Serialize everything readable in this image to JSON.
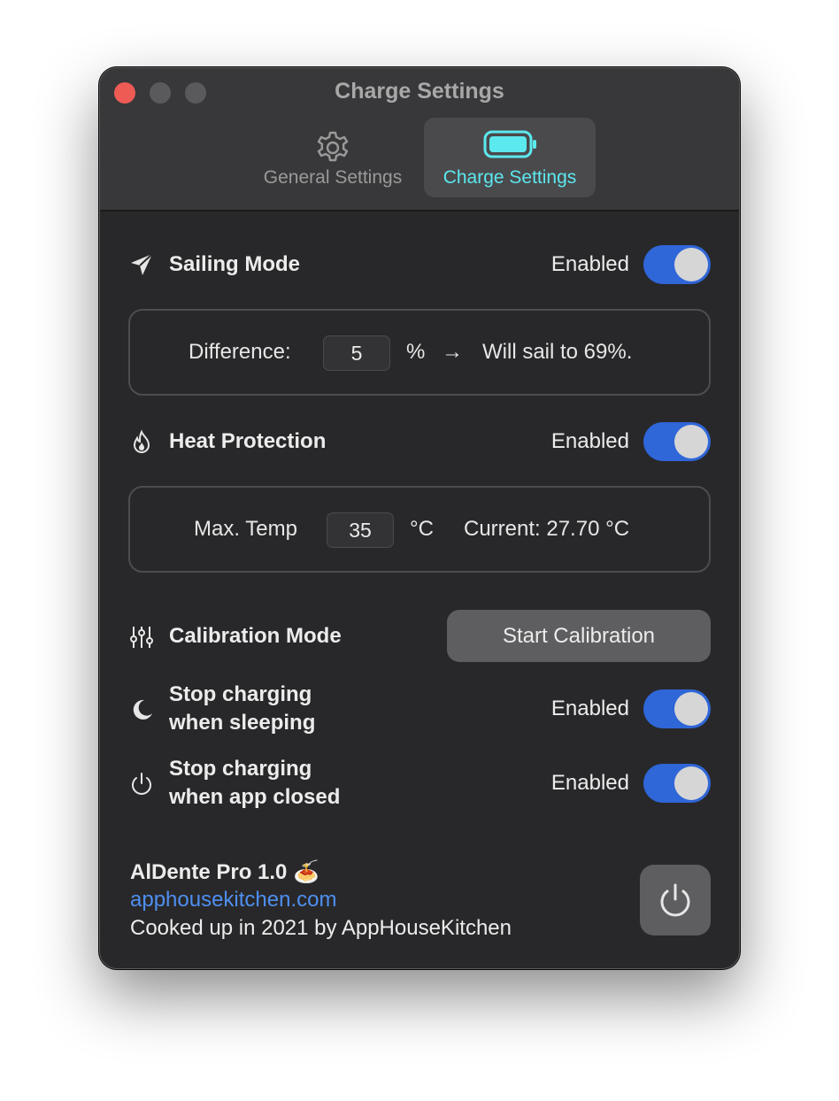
{
  "window": {
    "title": "Charge Settings"
  },
  "tabs": [
    {
      "label": "General Settings",
      "icon": "gear-icon",
      "selected": false
    },
    {
      "label": "Charge Settings",
      "icon": "battery-icon",
      "selected": true
    }
  ],
  "sailing": {
    "title": "Sailing Mode",
    "status": "Enabled",
    "enabled": true,
    "difference_label": "Difference:",
    "difference_value": "5",
    "unit": "%",
    "arrow": "→",
    "result": "Will sail to 69%."
  },
  "heat": {
    "title": "Heat Protection",
    "status": "Enabled",
    "enabled": true,
    "max_temp_label": "Max. Temp",
    "max_temp_value": "35",
    "unit": "°C",
    "current": "Current: 27.70 °C"
  },
  "calibration": {
    "title": "Calibration Mode",
    "button_label": "Start Calibration"
  },
  "sleep": {
    "title_line1": "Stop charging",
    "title_line2": "when sleeping",
    "status": "Enabled",
    "enabled": true
  },
  "app_closed": {
    "title_line1": "Stop charging",
    "title_line2": "when app closed",
    "status": "Enabled",
    "enabled": true
  },
  "footer": {
    "app_name": "AlDente Pro 1.0",
    "emoji": "🍝",
    "link": "apphousekitchen.com",
    "credit": "Cooked up in 2021 by AppHouseKitchen"
  },
  "colors": {
    "accent": "#2f66d8",
    "selected_tab_text": "#5ce8ef",
    "link": "#4e8ff0",
    "close_button": "#ee5b55"
  }
}
